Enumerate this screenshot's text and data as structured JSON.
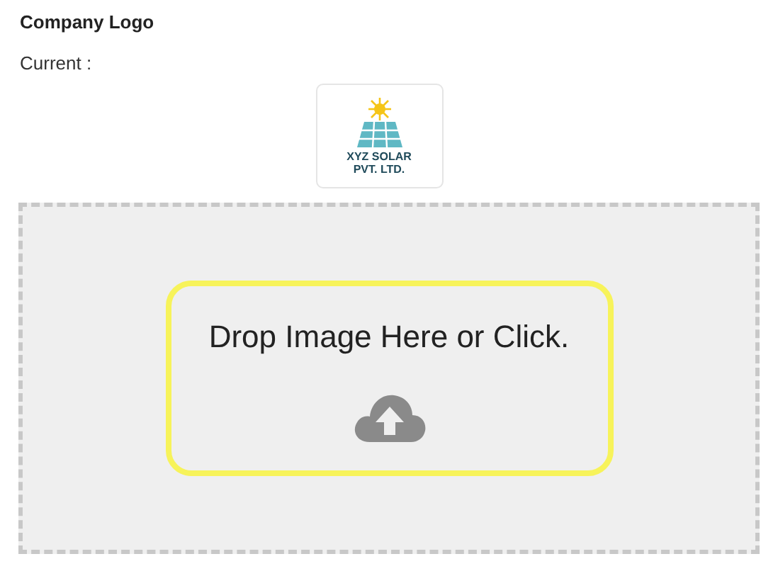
{
  "heading": "Company Logo",
  "current_label": "Current :",
  "logo": {
    "lines": [
      "XYZ SOLAR",
      "PVT. LTD."
    ]
  },
  "dropzone": {
    "message": "Drop Image Here or Click.",
    "highlighted": true
  }
}
